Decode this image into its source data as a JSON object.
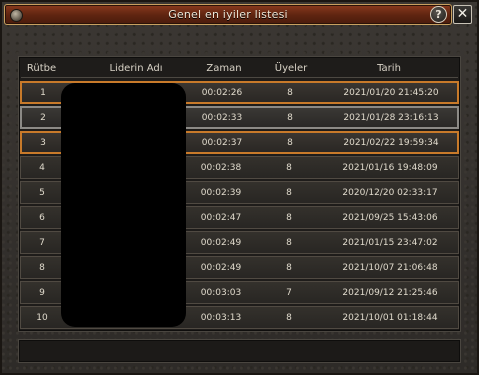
{
  "window": {
    "title": "Genel en iyiler listesi",
    "help_label": "?",
    "close_label": "✕"
  },
  "columns": {
    "rank": "Rütbe",
    "leader": "Liderin Adı",
    "time": "Zaman",
    "members": "Üyeler",
    "date": "Tarih"
  },
  "rows": [
    {
      "rank": "1",
      "time": "00:02:26",
      "members": "8",
      "date": "2021/01/20 21:45:20"
    },
    {
      "rank": "2",
      "time": "00:02:33",
      "members": "8",
      "date": "2021/01/28 23:16:13"
    },
    {
      "rank": "3",
      "time": "00:02:37",
      "members": "8",
      "date": "2021/02/22 19:59:34"
    },
    {
      "rank": "4",
      "time": "00:02:38",
      "members": "8",
      "date": "2021/01/16 19:48:09"
    },
    {
      "rank": "5",
      "time": "00:02:39",
      "members": "8",
      "date": "2020/12/20 02:33:17"
    },
    {
      "rank": "6",
      "time": "00:02:47",
      "members": "8",
      "date": "2021/09/25 15:43:06"
    },
    {
      "rank": "7",
      "time": "00:02:49",
      "members": "8",
      "date": "2021/01/15 23:47:02"
    },
    {
      "rank": "8",
      "time": "00:02:49",
      "members": "8",
      "date": "2021/10/07 21:06:48"
    },
    {
      "rank": "9",
      "time": "00:03:03",
      "members": "7",
      "date": "2021/09/12 21:25:46"
    },
    {
      "rank": "10",
      "time": "00:03:13",
      "members": "8",
      "date": "2021/10/01 01:18:44"
    }
  ],
  "colors": {
    "highlight_orange": "#c87a2a",
    "highlight_gray": "#8c8a86",
    "title_bar": "#5e2410"
  }
}
